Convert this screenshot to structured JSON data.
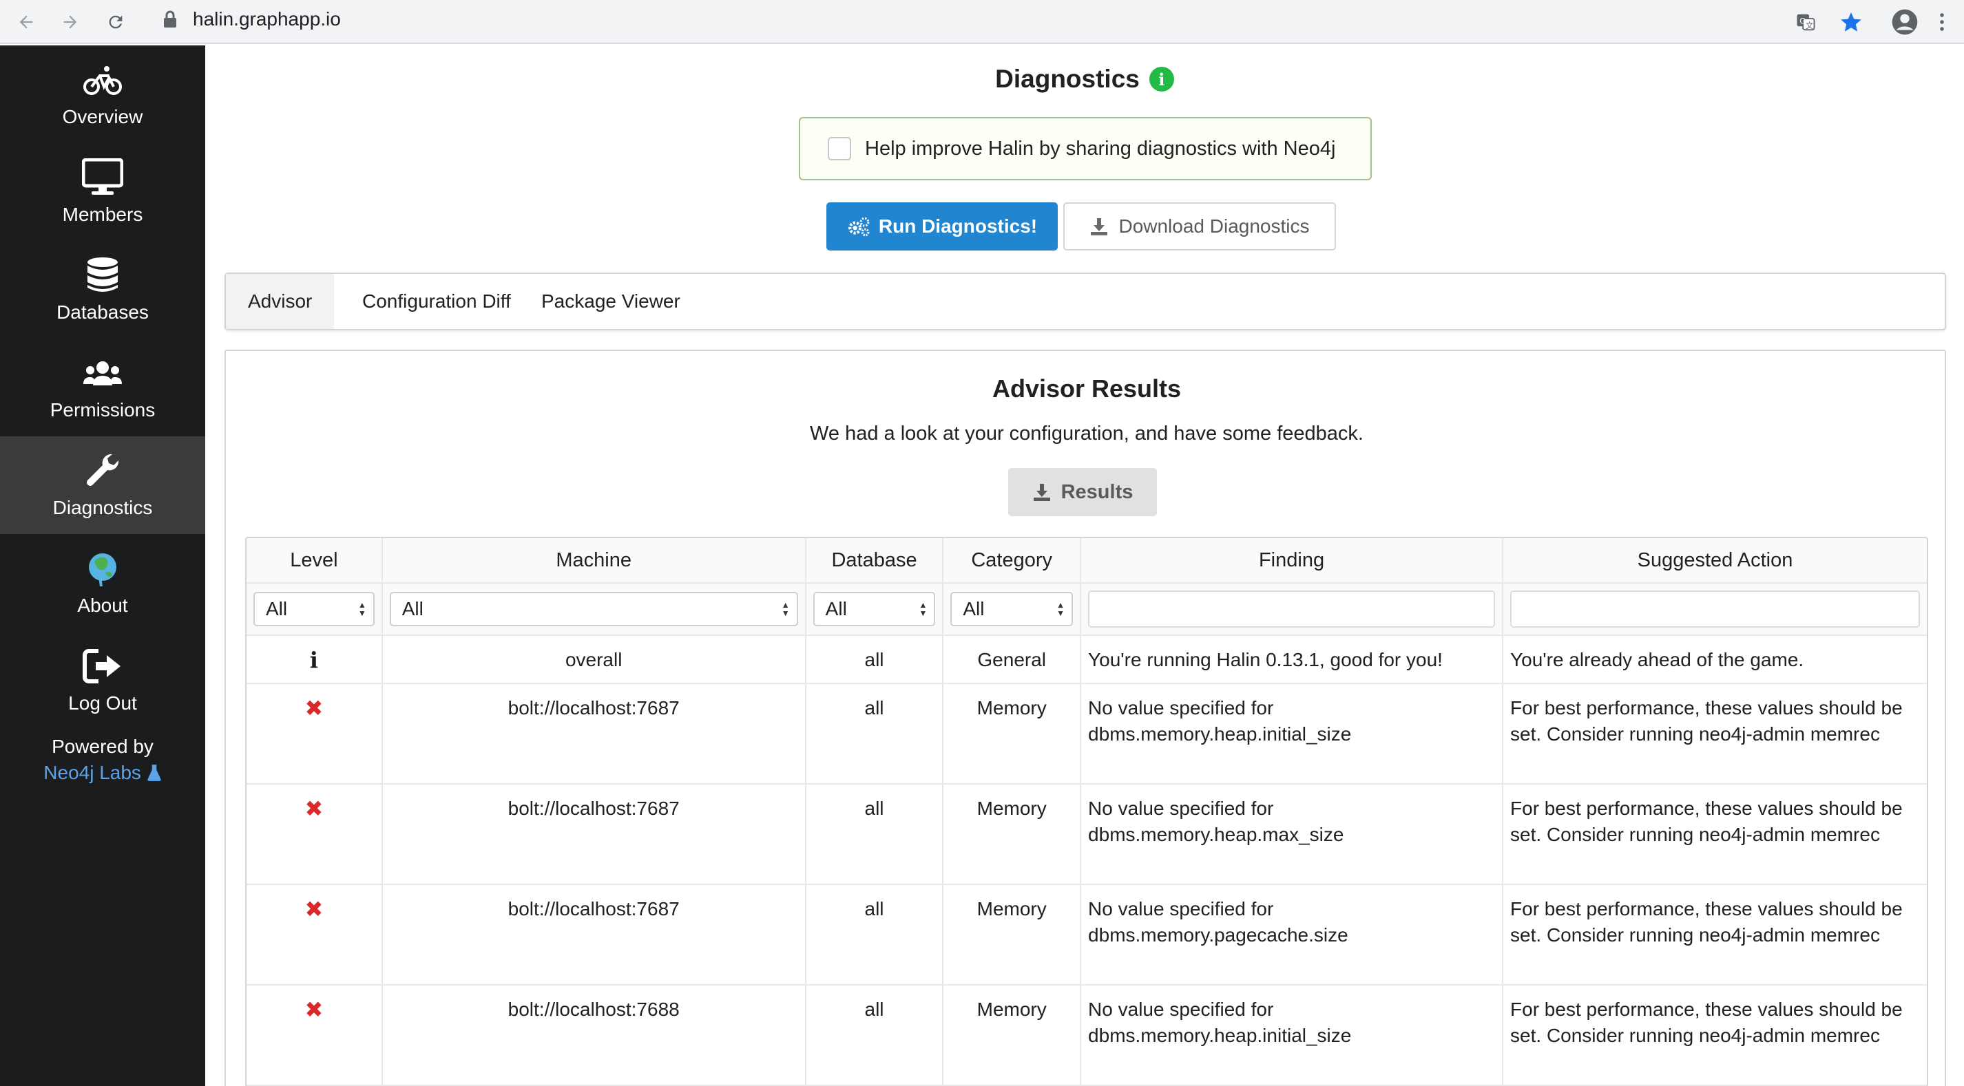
{
  "browser": {
    "url": "halin.graphapp.io",
    "icons": [
      "back-arrow-icon",
      "forward-arrow-icon",
      "reload-icon",
      "lock-icon",
      "translate-icon",
      "bookmark-star-icon",
      "account-icon",
      "more-vert-icon"
    ],
    "accent": "#1a73e8"
  },
  "sidebar": {
    "items": [
      {
        "label": "Overview",
        "icon": "bicycle-icon"
      },
      {
        "label": "Members",
        "icon": "desktop-icon"
      },
      {
        "label": "Databases",
        "icon": "database-icon"
      },
      {
        "label": "Permissions",
        "icon": "users-icon"
      },
      {
        "label": "Diagnostics",
        "icon": "wrench-icon",
        "active": true
      },
      {
        "label": "About",
        "icon": "neo4j-logo-icon"
      },
      {
        "label": "Log Out",
        "icon": "sign-out-icon"
      }
    ],
    "powered_by": "Powered by",
    "labs": "Neo4j Labs",
    "colors": {
      "bg": "#1b1c1d",
      "active": "#3a3b3c",
      "link": "#5ba3e6"
    }
  },
  "main": {
    "title": "Diagnostics",
    "share_label": "Help improve Halin by sharing diagnostics with Neo4j",
    "run_button": "Run Diagnostics!",
    "download_button": "Download Diagnostics",
    "tabs": [
      {
        "label": "Advisor",
        "active": true
      },
      {
        "label": "Configuration Diff"
      },
      {
        "label": "Package Viewer"
      }
    ],
    "advisor": {
      "title": "Advisor Results",
      "subtitle": "We had a look at your configuration, and have some feedback.",
      "results_button": "Results",
      "columns": [
        "Level",
        "Machine",
        "Database",
        "Category",
        "Finding",
        "Suggested Action"
      ],
      "filters": {
        "level": "All",
        "machine": "All",
        "database": "All",
        "category": "All"
      },
      "rows": [
        {
          "level": "info",
          "machine": "overall",
          "database": "all",
          "category": "General",
          "finding": "You're running Halin 0.13.1, good for you!",
          "action": "You're already ahead of the game."
        },
        {
          "level": "error",
          "machine": "bolt://localhost:7687",
          "database": "all",
          "category": "Memory",
          "finding": "No value specified for dbms.memory.heap.initial_size",
          "action": "For best performance, these values should be set. Consider running neo4j-admin memrec"
        },
        {
          "level": "error",
          "machine": "bolt://localhost:7687",
          "database": "all",
          "category": "Memory",
          "finding": "No value specified for dbms.memory.heap.max_size",
          "action": "For best performance, these values should be set. Consider running neo4j-admin memrec"
        },
        {
          "level": "error",
          "machine": "bolt://localhost:7687",
          "database": "all",
          "category": "Memory",
          "finding": "No value specified for dbms.memory.pagecache.size",
          "action": "For best performance, these values should be set. Consider running neo4j-admin memrec"
        },
        {
          "level": "error",
          "machine": "bolt://localhost:7688",
          "database": "all",
          "category": "Memory",
          "finding": "No value specified for dbms.memory.heap.initial_size",
          "action": "For best performance, these values should be set. Consider running neo4j-admin memrec"
        }
      ],
      "colors": {
        "primary": "#2185d0",
        "info": "#21ba45",
        "error": "#db2828",
        "share_border": "#a3c293"
      }
    }
  }
}
